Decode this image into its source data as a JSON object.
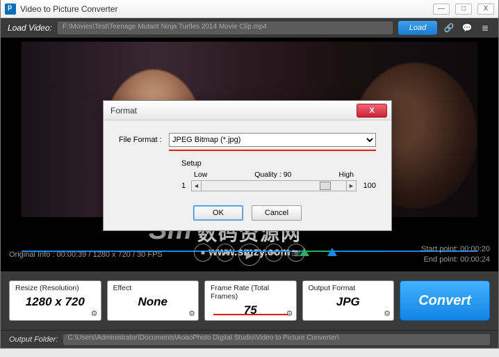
{
  "window": {
    "title": "Video to Picture Converter",
    "min": "—",
    "max": "□",
    "close": "X"
  },
  "loadbar": {
    "label": "Load Video:",
    "path": "F:\\Movies\\Test\\Teenage Mutant Ninja Turtles 2014 Movie Clip.mp4",
    "button": "Load"
  },
  "watermark": {
    "cn": "数码资源网",
    "en": "www.smzy.com",
    "logo": "Sm"
  },
  "info": {
    "original": "Original Info : 00:00:39 / 1280 x 720 / 30 FPS",
    "start_label": "Start point:",
    "start_value": "00:00:20",
    "end_label": "End point:",
    "end_value": "00:00:24"
  },
  "controls": {
    "stop": "■",
    "prev": "|◀",
    "play": "▶",
    "next": "▶|",
    "snap": "📷"
  },
  "config": {
    "resize": {
      "header": "Resize (Resolution)",
      "value": "1280 x 720"
    },
    "effect": {
      "header": "Effect",
      "value": "None"
    },
    "framerate": {
      "header": "Frame Rate (Total Frames)",
      "value": "75"
    },
    "format": {
      "header": "Output Format",
      "value": "JPG"
    },
    "gear": "⚙",
    "convert": "Convert"
  },
  "output": {
    "label": "Output Folder:",
    "path": "C:\\Users\\Administrator\\Documents\\AoaoPhoto Digital Studio\\Video to Picture Converter\\"
  },
  "dialog": {
    "title": "Format",
    "close": "X",
    "file_format_label": "File Format :",
    "file_format_value": "JPEG Bitmap (*.jpg)",
    "setup_label": "Setup",
    "low": "Low",
    "quality": "Quality : 90",
    "high": "High",
    "min": "1",
    "max": "100",
    "ok": "OK",
    "cancel": "Cancel"
  }
}
